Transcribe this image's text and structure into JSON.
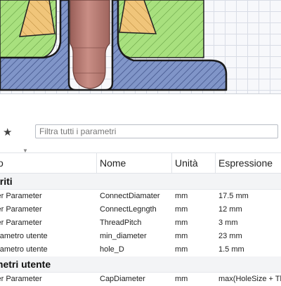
{
  "search": {
    "placeholder": "Filtra tutti i parametri",
    "value": ""
  },
  "toolbar": {
    "favorites_icon": "star-icon"
  },
  "table": {
    "headers": [
      "o",
      "Nome",
      "Unità",
      "Espressione"
    ],
    "groups": [
      {
        "title": "eriti",
        "rows": [
          {
            "source": "ser Parameter",
            "name": "ConnectDiamater",
            "unit": "mm",
            "expression": "17.5 mm"
          },
          {
            "source": "ser Parameter",
            "name": "ConnectLegngth",
            "unit": "mm",
            "expression": "12 mm"
          },
          {
            "source": "ser Parameter",
            "name": "ThreadPitch",
            "unit": "mm",
            "expression": "3 mm"
          },
          {
            "source": "arametro utente",
            "name": "min_diameter",
            "unit": "mm",
            "expression": "23 mm"
          },
          {
            "source": "arametro utente",
            "name": "hole_D",
            "unit": "mm",
            "expression": "1.5 mm"
          }
        ]
      },
      {
        "title": "metri utente",
        "rows": [
          {
            "source": "ser Parameter",
            "name": "CapDiameter",
            "unit": "mm",
            "expression": "max(HoleSize + Th"
          }
        ]
      }
    ]
  },
  "colors": {
    "green_fill": "#a8e07e",
    "tan_fill": "#f0c57a",
    "blue_fill": "#8095c8",
    "rod_fill": "#b87a72"
  }
}
